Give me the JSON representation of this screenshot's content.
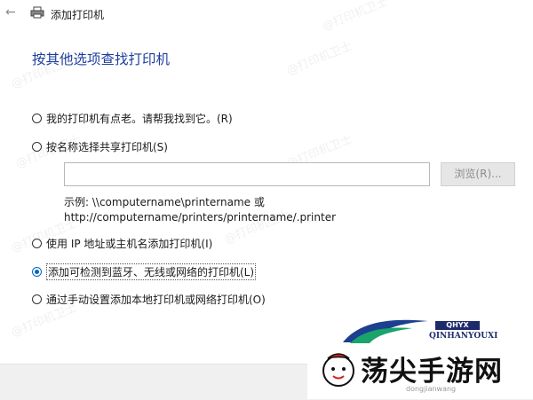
{
  "window": {
    "title": "添加打印机"
  },
  "heading": "按其他选项查找打印机",
  "options": [
    {
      "label": "我的打印机有点老。请帮我找到它。(R)",
      "selected": false
    },
    {
      "label": "按名称选择共享打印机(S)",
      "selected": false
    },
    {
      "label": "使用 IP 地址或主机名添加打印机(I)",
      "selected": false
    },
    {
      "label": "添加可检测到蓝牙、无线或网络的打印机(L)",
      "selected": true
    },
    {
      "label": "通过手动设置添加本地打印机或网络打印机(O)",
      "selected": false
    }
  ],
  "shared_name": {
    "value": "",
    "browse_label": "浏览(R)..."
  },
  "example": {
    "line1": "示例: \\\\computername\\printername 或",
    "line2": "http://computername/printers/printername/.printer"
  },
  "watermark": "@打印机卫士",
  "logo": {
    "text": "荡尖手游网",
    "badge": "QHYX",
    "english": "QINHANYOUXI",
    "url": "dongjianwang"
  },
  "colors": {
    "accent": "#0067c0",
    "heading": "#1e3f9e"
  }
}
